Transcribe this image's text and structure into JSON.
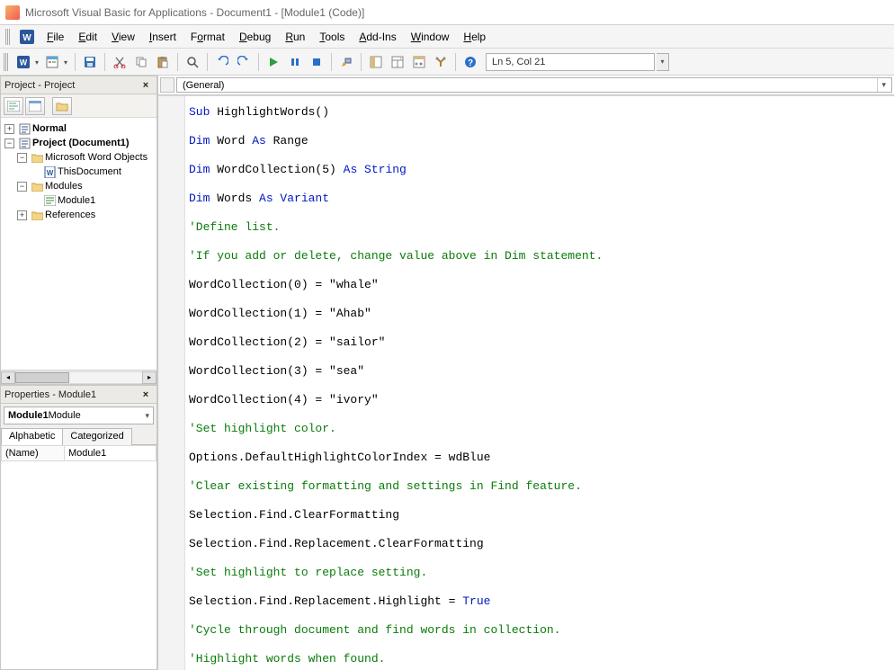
{
  "title": "Microsoft Visual Basic for Applications - Document1 - [Module1 (Code)]",
  "menu": {
    "file": "File",
    "edit": "Edit",
    "view": "View",
    "insert": "Insert",
    "format": "Format",
    "debug": "Debug",
    "run": "Run",
    "tools": "Tools",
    "addins": "Add-Ins",
    "window": "Window",
    "help": "Help"
  },
  "toolbar": {
    "status": "Ln 5, Col 21"
  },
  "project_pane": {
    "title": "Project - Project",
    "nodes": {
      "normal": "Normal",
      "project": "Project (Document1)",
      "mwo": "Microsoft Word Objects",
      "thisdoc": "ThisDocument",
      "modules": "Modules",
      "module1": "Module1",
      "references": "References"
    }
  },
  "properties_pane": {
    "title": "Properties - Module1",
    "combo_bold": "Module1",
    "combo_rest": " Module",
    "tabs": {
      "alphabetic": "Alphabetic",
      "categorized": "Categorized"
    },
    "rows": [
      {
        "name": "(Name)",
        "value": "Module1"
      }
    ]
  },
  "editor": {
    "left_combo": "(General)",
    "right_combo": ""
  },
  "code": {
    "l1": {
      "kw": "Sub",
      "rest": " HighlightWords()"
    },
    "l2": {
      "kw1": "Dim",
      "mid": " Word ",
      "kw2": "As",
      "rest": " Range"
    },
    "l3": {
      "kw1": "Dim",
      "mid": " WordCollection(5) ",
      "kw2": "As",
      "kw3": " String"
    },
    "l4": {
      "kw1": "Dim",
      "mid": " Words ",
      "kw2": "As",
      "kw3": " Variant"
    },
    "l5": "'Define list.",
    "l6": "'If you add or delete, change value above in Dim statement.",
    "l7": "WordCollection(0) = \"whale\"",
    "l8": "WordCollection(1) = \"Ahab\"",
    "l9": "WordCollection(2) = \"sailor\"",
    "l10": "WordCollection(3) = \"sea\"",
    "l11": "WordCollection(4) = \"ivory\"",
    "l12": "'Set highlight color.",
    "l13": "Options.DefaultHighlightColorIndex = wdBlue",
    "l14": "'Clear existing formatting and settings in Find feature.",
    "l15": "Selection.Find.ClearFormatting",
    "l16": "Selection.Find.Replacement.ClearFormatting",
    "l17": "'Set highlight to replace setting.",
    "l18a": "Selection.Find.Replacement.Highlight = ",
    "l18b": "True",
    "l19": "'Cycle through document and find words in collection.",
    "l20": "'Highlight words when found."
  }
}
